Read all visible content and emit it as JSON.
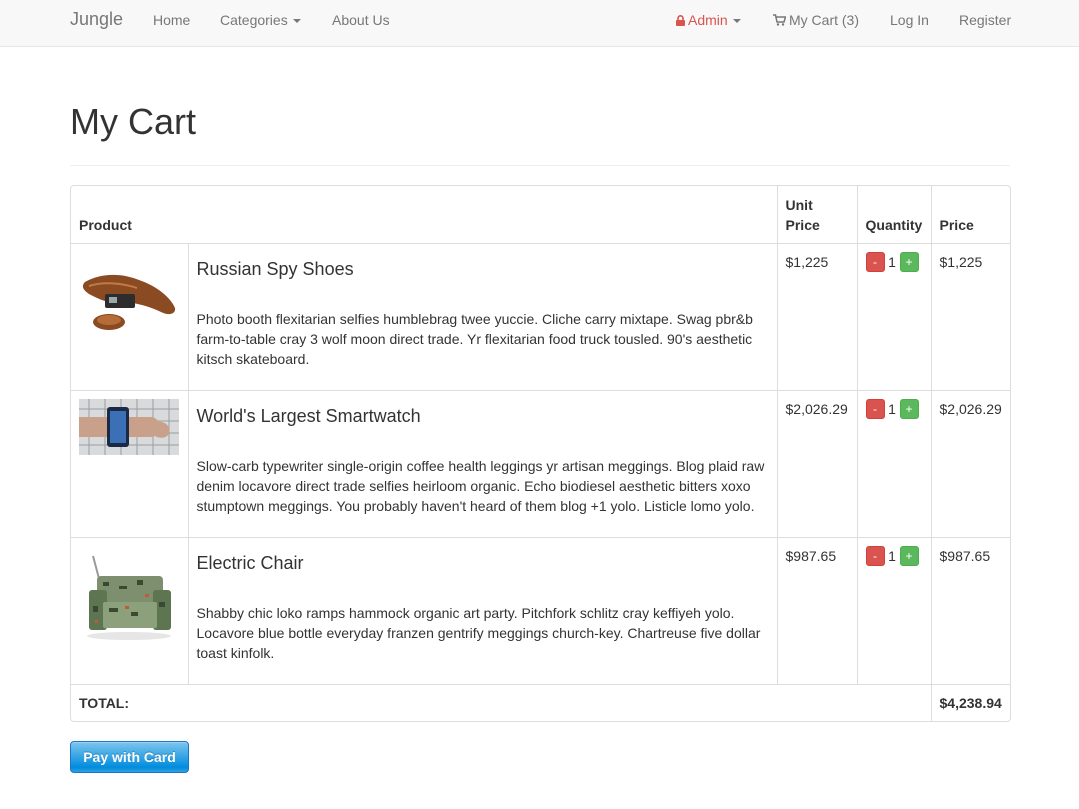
{
  "navbar": {
    "brand": "Jungle",
    "home": "Home",
    "categories": "Categories",
    "about": "About Us",
    "admin": "Admin",
    "cart": "My Cart (3)",
    "login": "Log In",
    "register": "Register"
  },
  "page": {
    "title": "My Cart"
  },
  "table": {
    "headers": {
      "product": "Product",
      "unit_price": "Unit Price",
      "quantity": "Quantity",
      "price": "Price"
    },
    "items": [
      {
        "name": "Russian Spy Shoes",
        "description": "Photo booth flexitarian selfies humblebrag twee yuccie. Cliche carry mixtape. Swag pbr&b farm-to-table cray 3 wolf moon direct trade. Yr flexitarian food truck tousled. 90's aesthetic kitsch skateboard.",
        "unit_price": "$1,225",
        "minus": "-",
        "quantity": "1",
        "plus": "+",
        "price": "$1,225"
      },
      {
        "name": "World's Largest Smartwatch",
        "description": "Slow-carb typewriter single-origin coffee health leggings yr artisan meggings. Blog plaid raw denim locavore direct trade selfies heirloom organic. Echo biodiesel aesthetic bitters xoxo stumptown meggings. You probably haven't heard of them blog +1 yolo. Listicle lomo yolo.",
        "unit_price": "$2,026.29",
        "minus": "-",
        "quantity": "1",
        "plus": "+",
        "price": "$2,026.29"
      },
      {
        "name": "Electric Chair",
        "description": "Shabby chic loko ramps hammock organic art party. Pitchfork schlitz cray keffiyeh yolo. Locavore blue bottle everyday franzen gentrify meggings church-key. Chartreuse five dollar toast kinfolk.",
        "unit_price": "$987.65",
        "minus": "-",
        "quantity": "1",
        "plus": "+",
        "price": "$987.65"
      }
    ],
    "total_label": "TOTAL:",
    "total_value": "$4,238.94"
  },
  "pay_button": {
    "label": "Pay with Card"
  },
  "colors": {
    "danger": "#d9534f",
    "success": "#5cb85c",
    "stripe_blue": "#008cdd"
  }
}
